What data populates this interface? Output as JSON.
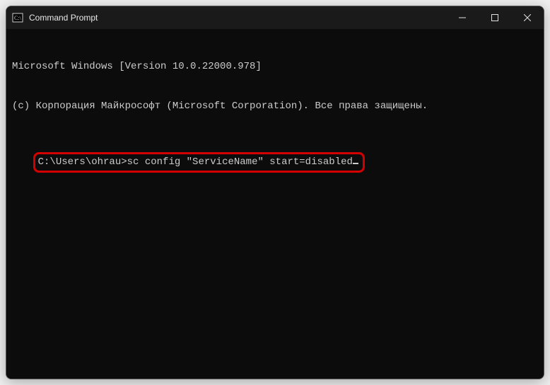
{
  "window": {
    "title": "Command Prompt"
  },
  "terminal": {
    "line1": "Microsoft Windows [Version 10.0.22000.978]",
    "line2": "(c) Корпорация Майкрософт (Microsoft Corporation). Все права защищены.",
    "blank": "",
    "prompt": "C:\\Users\\ohrau>",
    "command": "sc config \"ServiceName\" start=disabled"
  }
}
